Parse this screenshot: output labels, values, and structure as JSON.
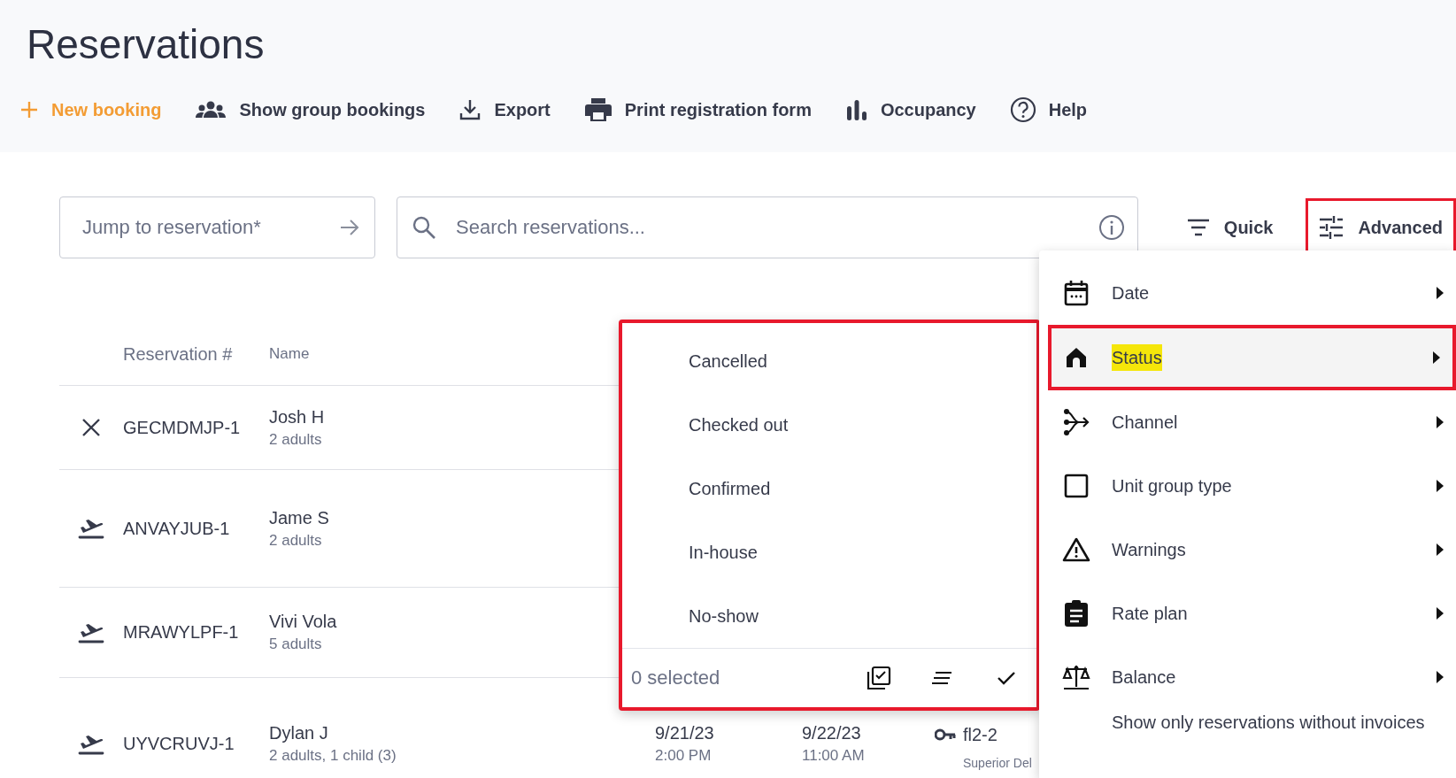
{
  "page": {
    "title": "Reservations"
  },
  "toolbar": [
    {
      "label": "New booking",
      "kind": "new"
    },
    {
      "label": "Show group bookings",
      "kind": "group"
    },
    {
      "label": "Export",
      "kind": "export"
    },
    {
      "label": "Print registration form",
      "kind": "print"
    },
    {
      "label": "Occupancy",
      "kind": "occupancy"
    },
    {
      "label": "Help",
      "kind": "help"
    }
  ],
  "jump_field": {
    "placeholder": "Jump to reservation*"
  },
  "search_field": {
    "placeholder": "Search reservations..."
  },
  "filter_buttons": [
    {
      "label": "Quick",
      "kind": "quick",
      "annotated": false
    },
    {
      "label": "Advanced",
      "kind": "advanced",
      "annotated": true
    }
  ],
  "table": {
    "columns": [
      "Reservation #",
      "Name"
    ],
    "rows": [
      {
        "kind": "cancelled",
        "number": "GECMDMJP-1",
        "name": "Josh H",
        "guests": "2 adults"
      },
      {
        "kind": "arrival",
        "number": "ANVAYJUB-1",
        "name": "Jame S",
        "guests": "2 adults"
      },
      {
        "kind": "arrival",
        "number": "MRAWYLPF-1",
        "name": "Vivi Vola",
        "guests": "5 adults"
      },
      {
        "kind": "arrival",
        "number": "UYVCRUVJ-1",
        "name": "Dylan J",
        "guests": "2 adults, 1 child (3)",
        "arrival": {
          "date": "9/21/23",
          "time": "2:00 PM"
        },
        "departure": {
          "date": "9/22/23",
          "time": "11:00 AM"
        },
        "unit": {
          "line_2": "fl2-2",
          "line_3": "Superior Del"
        }
      }
    ]
  },
  "status_popup": {
    "annotated": true,
    "options": [
      {
        "label": "Cancelled",
        "selected": false
      },
      {
        "label": "Checked out",
        "selected": false
      },
      {
        "label": "Confirmed",
        "selected": false
      },
      {
        "label": "In-house",
        "selected": false
      },
      {
        "label": "No-show",
        "selected": false
      }
    ],
    "count": "0 selected"
  },
  "advanced_menu": {
    "items": [
      {
        "label": "Date",
        "kind": "date",
        "selected": false,
        "annotated": false
      },
      {
        "label": "Status",
        "kind": "status",
        "selected": true,
        "annotated": true
      },
      {
        "label": "Channel",
        "kind": "channel",
        "selected": false,
        "annotated": false
      },
      {
        "label": "Unit group type",
        "kind": "unit",
        "selected": false,
        "annotated": false
      },
      {
        "label": "Warnings",
        "kind": "warning",
        "selected": false,
        "annotated": false
      },
      {
        "label": "Rate plan",
        "kind": "rate",
        "selected": false,
        "annotated": false
      },
      {
        "label": "Balance",
        "kind": "balance",
        "selected": false,
        "annotated": false
      },
      {
        "label": "Show only reservations without invoices",
        "kind": "toggle",
        "selected": false,
        "annotated": false
      }
    ]
  }
}
